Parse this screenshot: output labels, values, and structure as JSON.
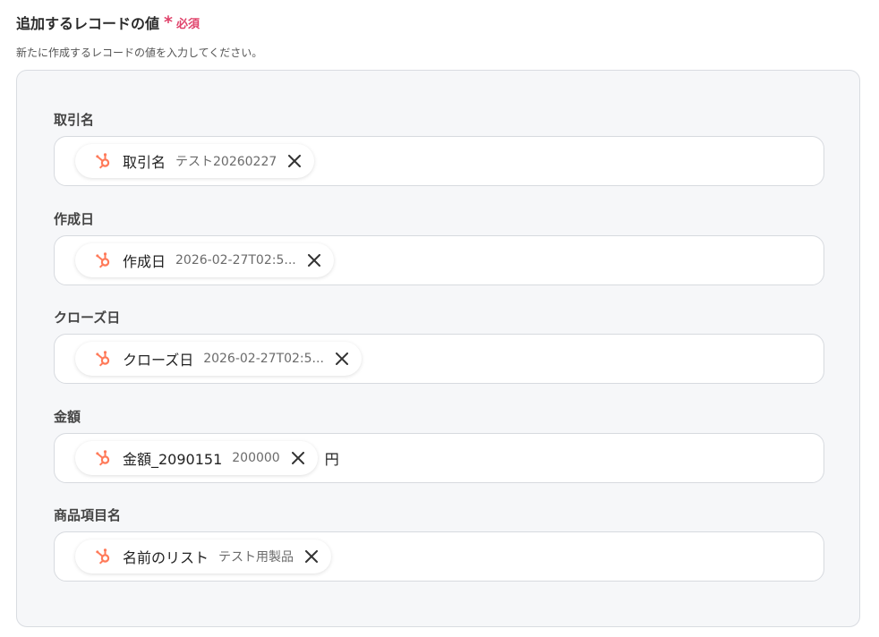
{
  "section": {
    "title": "追加するレコードの値",
    "required_mark": "*",
    "required_label": "必須",
    "description": "新たに作成するレコードの値を入力してください。"
  },
  "colors": {
    "required": "#e0436b",
    "hubspot": "#ff7a59"
  },
  "fields": [
    {
      "label": "取引名",
      "chip": {
        "icon": "hubspot-icon",
        "name": "取引名",
        "value": "テスト20260227"
      },
      "suffix": ""
    },
    {
      "label": "作成日",
      "chip": {
        "icon": "hubspot-icon",
        "name": "作成日",
        "value": "2026-02-27T02:5..."
      },
      "suffix": ""
    },
    {
      "label": "クローズ日",
      "chip": {
        "icon": "hubspot-icon",
        "name": "クローズ日",
        "value": "2026-02-27T02:5..."
      },
      "suffix": ""
    },
    {
      "label": "金額",
      "chip": {
        "icon": "hubspot-icon",
        "name": "金額_2090151",
        "value": "200000"
      },
      "suffix": "円"
    },
    {
      "label": "商品項目名",
      "chip": {
        "icon": "hubspot-icon",
        "name": "名前のリスト",
        "value": "テスト用製品"
      },
      "suffix": ""
    }
  ]
}
